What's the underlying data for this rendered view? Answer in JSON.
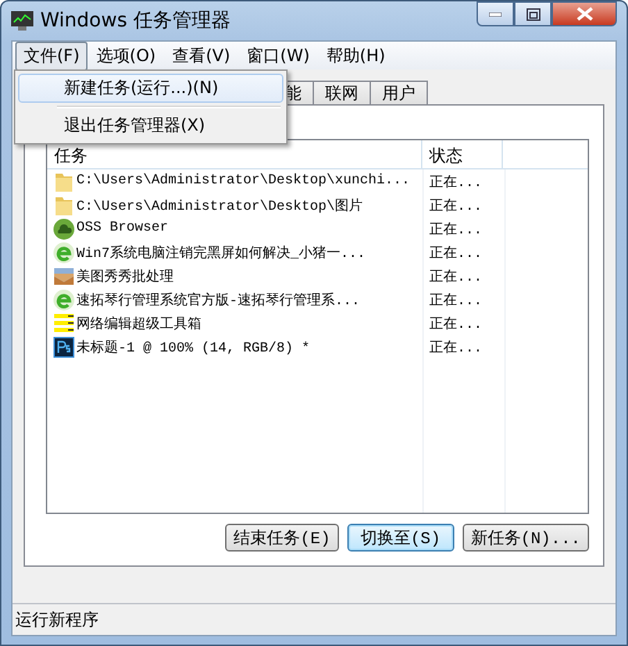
{
  "window": {
    "title": "Windows 任务管理器"
  },
  "menu_bar": [
    {
      "label": "文件(F)",
      "selected": true
    },
    {
      "label": "选项(O)",
      "selected": false
    },
    {
      "label": "查看(V)",
      "selected": false
    },
    {
      "label": "窗口(W)",
      "selected": false
    },
    {
      "label": "帮助(H)",
      "selected": false
    }
  ],
  "file_menu": [
    {
      "label": "新建任务(运行...)(N)",
      "selected": true
    },
    {
      "label": "退出任务管理器(X)",
      "selected": false
    }
  ],
  "tabs": [
    {
      "label": "能",
      "selected": false
    },
    {
      "label": "联网",
      "selected": false
    },
    {
      "label": "用户",
      "selected": false
    }
  ],
  "table": {
    "columns": [
      "任务",
      "状态"
    ],
    "rows": [
      {
        "kind": "folder",
        "task": "C:\\Users\\Administrator\\Desktop\\xunchi...",
        "status": "正在..."
      },
      {
        "kind": "folder",
        "task": "C:\\Users\\Administrator\\Desktop\\图片",
        "status": "正在..."
      },
      {
        "kind": "cloud",
        "task": "OSS Browser",
        "status": "正在..."
      },
      {
        "kind": "browser",
        "task": "Win7系统电脑注销完黑屏如何解决_小猪一...",
        "status": "正在..."
      },
      {
        "kind": "image",
        "task": "美图秀秀批处理",
        "status": "正在..."
      },
      {
        "kind": "browser",
        "task": "速拓琴行管理系统官方版-速拓琴行管理系...",
        "status": "正在..."
      },
      {
        "kind": "lines",
        "task": "网络编辑超级工具箱",
        "status": "正在..."
      },
      {
        "kind": "ps",
        "task": "未标题-1 @ 100% (14, RGB/8) *",
        "status": "正在..."
      }
    ]
  },
  "buttons": [
    {
      "label": "结束任务(E)",
      "selected": false
    },
    {
      "label": "切换至(S)",
      "selected": true
    },
    {
      "label": "新任务(N)...",
      "selected": false
    }
  ],
  "status_bar": "运行新程序"
}
